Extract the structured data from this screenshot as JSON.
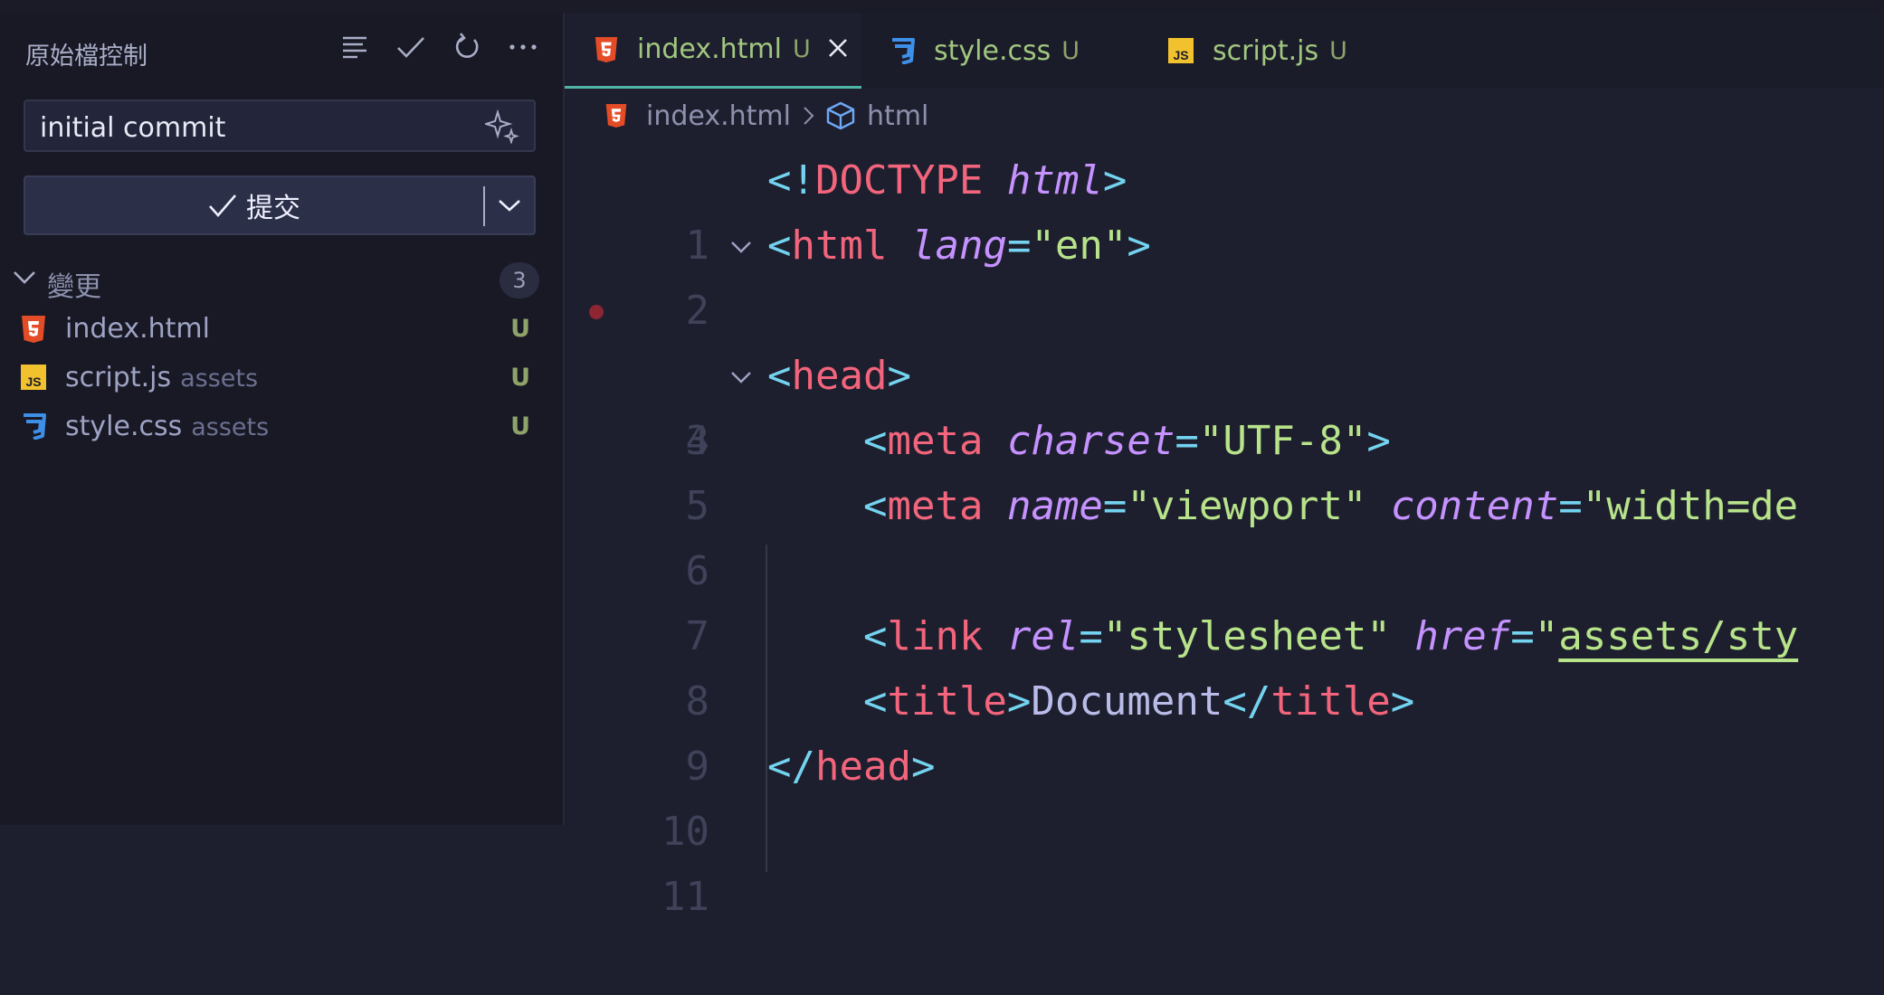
{
  "sidebar": {
    "title": "原始檔控制",
    "commit_message": "initial commit",
    "commit_button_label": "提交",
    "changes_label": "變更",
    "changes_count": "3",
    "files": [
      {
        "name": "index.html",
        "dir": "",
        "status": "U",
        "icon": "html5-file-icon"
      },
      {
        "name": "script.js",
        "dir": "assets",
        "status": "U",
        "icon": "js-file-icon"
      },
      {
        "name": "style.css",
        "dir": "assets",
        "status": "U",
        "icon": "css3-file-icon"
      }
    ]
  },
  "tabs": [
    {
      "label": "index.html",
      "status": "U",
      "active": true
    },
    {
      "label": "style.css",
      "status": "U",
      "active": false
    },
    {
      "label": "script.js",
      "status": "U",
      "active": false
    }
  ],
  "breadcrumb": {
    "file": "index.html",
    "symbol": "html"
  },
  "code": {
    "line_numbers": [
      "1",
      "2",
      "3",
      "4",
      "5",
      "6",
      "7",
      "8",
      "9",
      "10",
      "11"
    ],
    "lines": [
      [
        "<!",
        "DOCTYPE",
        " ",
        "html",
        ">"
      ],
      [
        "<",
        "html",
        " ",
        "lang",
        "=",
        "\"en\"",
        ">"
      ],
      [],
      [
        "<",
        "head",
        ">"
      ],
      [
        "    ",
        "<",
        "meta",
        " ",
        "charset",
        "=",
        "\"UTF-8\"",
        ">"
      ],
      [
        "    ",
        "<",
        "meta",
        " ",
        "name",
        "=",
        "\"viewport\"",
        " ",
        "content",
        "=",
        "\"width=de"
      ],
      [],
      [
        "    ",
        "<",
        "link",
        " ",
        "rel",
        "=",
        "\"stylesheet\"",
        " ",
        "href",
        "=",
        "\"",
        "assets/sty"
      ],
      [
        "    ",
        "<",
        "title",
        ">",
        "Document",
        "</",
        "title",
        ">"
      ],
      [
        "</",
        "head",
        ">"
      ],
      []
    ]
  },
  "colors": {
    "tag": "#f2657c",
    "punctuation": "#73d3f0",
    "attribute": "#c592ff",
    "string": "#b7e38a",
    "text": "#b9bce8",
    "untracked": "#8ea36a",
    "breakpoint": "#8e2533"
  }
}
